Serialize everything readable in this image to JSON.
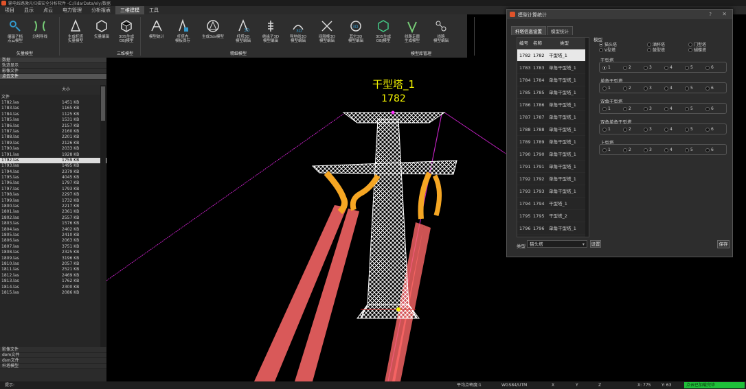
{
  "window": {
    "title": "输电线路激光扫描安全分析软件 -C:/lidarData/ely/数据"
  },
  "menu": [
    "项目",
    "显示",
    "点云",
    "电力管理",
    "分析报表",
    "三维建模",
    "工具"
  ],
  "menu_active_index": 5,
  "toolbar": {
    "buttons": [
      {
        "label": "编辑子档\n点云模型",
        "icon": "tower-edit-icon"
      },
      {
        "label": "分割导线",
        "icon": "split-wire-icon"
      },
      {
        "label": "生成杆塔\n矢量模型",
        "icon": "pole-vector-icon"
      },
      {
        "label": "矢量编辑",
        "icon": "vector-edit-icon"
      },
      {
        "label": "3DS生成\nOBJ模型",
        "icon": "cube-icon"
      },
      {
        "label": "模型统计",
        "icon": "model-stat-icon"
      },
      {
        "label": "杆塔内\n模板保存",
        "icon": "template-save-icon"
      },
      {
        "label": "生成3ds模型",
        "icon": "generate-3ds-icon"
      },
      {
        "label": "杆塔3D\n模型编辑",
        "icon": "tower-3d-icon"
      },
      {
        "label": "绝缘子3D\n模型编辑",
        "icon": "insulator-3d-icon"
      },
      {
        "label": "导地线3D\n模型编辑",
        "icon": "wire-3d-icon"
      },
      {
        "label": "间隔棒3D\n模型编辑",
        "icon": "spacer-3d-icon"
      },
      {
        "label": "其它3D\n模型编辑",
        "icon": "other-3d-icon"
      },
      {
        "label": "3DS生成\nOBJ模型",
        "icon": "obj-gen-icon"
      },
      {
        "label": "线路走廊\n生成模型",
        "icon": "corridor-icon"
      },
      {
        "label": "线路\n模型编辑",
        "icon": "route-edit-icon"
      }
    ],
    "groups": [
      "矢量模型",
      "三维模型",
      "精细模型",
      "模型库管理"
    ]
  },
  "left_panel": {
    "tabs": [
      "数据",
      "视图"
    ],
    "rows": [
      "轨迹显示",
      "影像文件",
      "点云文件"
    ],
    "columns": {
      "name": "文件",
      "size": "大小"
    },
    "files": [
      {
        "name": "1782.las",
        "size": "1451 KB"
      },
      {
        "name": "1783.las",
        "size": "1165 KB"
      },
      {
        "name": "1784.las",
        "size": "1125 KB"
      },
      {
        "name": "1785.las",
        "size": "1531 KB"
      },
      {
        "name": "1786.las",
        "size": "2157 KB"
      },
      {
        "name": "1787.las",
        "size": "2160 KB"
      },
      {
        "name": "1788.las",
        "size": "2201 KB"
      },
      {
        "name": "1789.las",
        "size": "2126 KB"
      },
      {
        "name": "1790.las",
        "size": "2033 KB"
      },
      {
        "name": "1791.las",
        "size": "1928 KB"
      },
      {
        "name": "1792.las",
        "size": "1759 KB"
      },
      {
        "name": "1793.las",
        "size": "1495 KB"
      },
      {
        "name": "1794.las",
        "size": "2379 KB"
      },
      {
        "name": "1795.las",
        "size": "4045 KB"
      },
      {
        "name": "1796.las",
        "size": "1797 KB"
      },
      {
        "name": "1797.las",
        "size": "1793 KB"
      },
      {
        "name": "1798.las",
        "size": "2297 KB"
      },
      {
        "name": "1799.las",
        "size": "1732 KB"
      },
      {
        "name": "1800.las",
        "size": "2217 KB"
      },
      {
        "name": "1801.las",
        "size": "2361 KB"
      },
      {
        "name": "1802.las",
        "size": "2557 KB"
      },
      {
        "name": "1803.las",
        "size": "1576 KB"
      },
      {
        "name": "1804.las",
        "size": "2402 KB"
      },
      {
        "name": "1805.las",
        "size": "2410 KB"
      },
      {
        "name": "1806.las",
        "size": "2063 KB"
      },
      {
        "name": "1807.las",
        "size": "3751 KB"
      },
      {
        "name": "1808.las",
        "size": "2325 KB"
      },
      {
        "name": "1809.las",
        "size": "3196 KB"
      },
      {
        "name": "1810.las",
        "size": "2057 KB"
      },
      {
        "name": "1811.las",
        "size": "2521 KB"
      },
      {
        "name": "1812.las",
        "size": "2469 KB"
      },
      {
        "name": "1813.las",
        "size": "1762 KB"
      },
      {
        "name": "1814.las",
        "size": "2300 KB"
      },
      {
        "name": "1815.las",
        "size": "2086 KB"
      }
    ],
    "selected_file": "1792.las",
    "bottom_rows": [
      "影像文件",
      "dem文件",
      "dsm文件",
      "杆塔模型"
    ]
  },
  "viewport": {
    "tower_name": "干型塔_1",
    "tower_number": "1782"
  },
  "dialog": {
    "title": "模型计算统计",
    "tabs": [
      "杆塔信息设置",
      "模型统计"
    ],
    "table_columns": [
      "编号",
      "名称",
      "类型"
    ],
    "rows": [
      {
        "id": "1782",
        "name": "1782",
        "type": "干型塔_1"
      },
      {
        "id": "1783",
        "name": "1783",
        "type": "单角干型塔_1"
      },
      {
        "id": "1784",
        "name": "1784",
        "type": "单角干型塔_1"
      },
      {
        "id": "1785",
        "name": "1785",
        "type": "单角干型塔_1"
      },
      {
        "id": "1786",
        "name": "1786",
        "type": "单角干型塔_1"
      },
      {
        "id": "1787",
        "name": "1787",
        "type": "单角干型塔_1"
      },
      {
        "id": "1788",
        "name": "1788",
        "type": "单角干型塔_1"
      },
      {
        "id": "1789",
        "name": "1789",
        "type": "单角干型塔_1"
      },
      {
        "id": "1790",
        "name": "1790",
        "type": "单角干型塔_1"
      },
      {
        "id": "1791",
        "name": "1791",
        "type": "单角干型塔_1"
      },
      {
        "id": "1792",
        "name": "1792",
        "type": "单角干型塔_1"
      },
      {
        "id": "1793",
        "name": "1793",
        "type": "单角干型塔_1"
      },
      {
        "id": "1794",
        "name": "1794",
        "type": "干型塔_1"
      },
      {
        "id": "1795",
        "name": "1795",
        "type": "干型塔_2"
      },
      {
        "id": "1796",
        "name": "1796",
        "type": "单角干型塔_1"
      },
      {
        "id": "1797",
        "name": "1797",
        "type": "单角干型塔_1"
      },
      {
        "id": "1798",
        "name": "1798",
        "type": "单角干型塔_1"
      }
    ],
    "model_group_title": "模型",
    "model_types": [
      "猫头塔",
      "酒杯塔",
      "门型塔",
      "V型塔",
      "鼓型塔",
      "蝴蝶塔"
    ],
    "subgroups": [
      "干型塔",
      "单角干型塔",
      "双角干型塔",
      "双角单角干型塔",
      "上型塔"
    ],
    "radio_numbers": [
      "1",
      "2",
      "3",
      "4",
      "5",
      "6"
    ],
    "type_label": "类型",
    "type_value": "猫头塔",
    "set_button": "设置",
    "save_button": "保存",
    "help_button": "?",
    "close_button": "✕"
  },
  "status": {
    "avg_density": "平均点密度:1",
    "crs": "WGS84/UTM",
    "x": "X",
    "y": "Y",
    "z": "Z",
    "x_value": "X: 775",
    "y_value": "Y: 63",
    "state": "点云已加载完毕"
  },
  "colors": {
    "tower": "#ffffff",
    "insulator": "#f5a623",
    "wire_left": "#ff6060",
    "wire_magenta": "#c020c0",
    "label": "#f5f500",
    "status_ok": "#1fc03a"
  }
}
